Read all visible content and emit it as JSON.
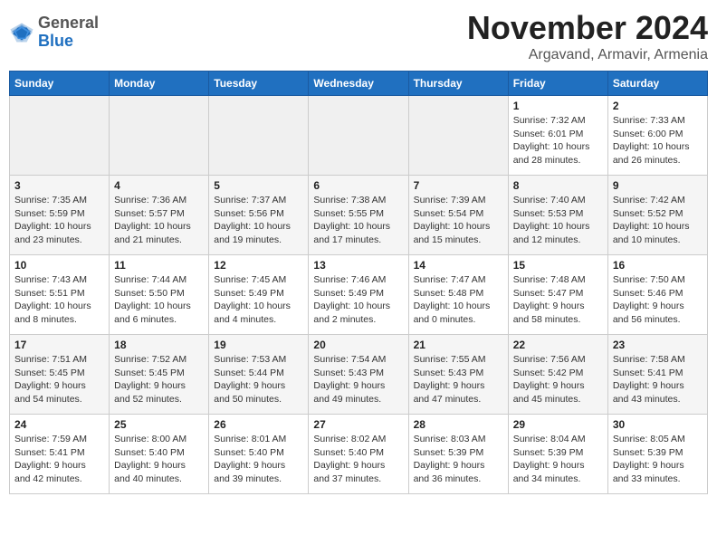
{
  "header": {
    "logo_line1": "General",
    "logo_line2": "Blue",
    "title": "November 2024",
    "subtitle": "Argavand, Armavir, Armenia"
  },
  "calendar": {
    "weekdays": [
      "Sunday",
      "Monday",
      "Tuesday",
      "Wednesday",
      "Thursday",
      "Friday",
      "Saturday"
    ],
    "weeks": [
      [
        {
          "day": "",
          "info": ""
        },
        {
          "day": "",
          "info": ""
        },
        {
          "day": "",
          "info": ""
        },
        {
          "day": "",
          "info": ""
        },
        {
          "day": "",
          "info": ""
        },
        {
          "day": "1",
          "info": "Sunrise: 7:32 AM\nSunset: 6:01 PM\nDaylight: 10 hours and 28 minutes."
        },
        {
          "day": "2",
          "info": "Sunrise: 7:33 AM\nSunset: 6:00 PM\nDaylight: 10 hours and 26 minutes."
        }
      ],
      [
        {
          "day": "3",
          "info": "Sunrise: 7:35 AM\nSunset: 5:59 PM\nDaylight: 10 hours and 23 minutes."
        },
        {
          "day": "4",
          "info": "Sunrise: 7:36 AM\nSunset: 5:57 PM\nDaylight: 10 hours and 21 minutes."
        },
        {
          "day": "5",
          "info": "Sunrise: 7:37 AM\nSunset: 5:56 PM\nDaylight: 10 hours and 19 minutes."
        },
        {
          "day": "6",
          "info": "Sunrise: 7:38 AM\nSunset: 5:55 PM\nDaylight: 10 hours and 17 minutes."
        },
        {
          "day": "7",
          "info": "Sunrise: 7:39 AM\nSunset: 5:54 PM\nDaylight: 10 hours and 15 minutes."
        },
        {
          "day": "8",
          "info": "Sunrise: 7:40 AM\nSunset: 5:53 PM\nDaylight: 10 hours and 12 minutes."
        },
        {
          "day": "9",
          "info": "Sunrise: 7:42 AM\nSunset: 5:52 PM\nDaylight: 10 hours and 10 minutes."
        }
      ],
      [
        {
          "day": "10",
          "info": "Sunrise: 7:43 AM\nSunset: 5:51 PM\nDaylight: 10 hours and 8 minutes."
        },
        {
          "day": "11",
          "info": "Sunrise: 7:44 AM\nSunset: 5:50 PM\nDaylight: 10 hours and 6 minutes."
        },
        {
          "day": "12",
          "info": "Sunrise: 7:45 AM\nSunset: 5:49 PM\nDaylight: 10 hours and 4 minutes."
        },
        {
          "day": "13",
          "info": "Sunrise: 7:46 AM\nSunset: 5:49 PM\nDaylight: 10 hours and 2 minutes."
        },
        {
          "day": "14",
          "info": "Sunrise: 7:47 AM\nSunset: 5:48 PM\nDaylight: 10 hours and 0 minutes."
        },
        {
          "day": "15",
          "info": "Sunrise: 7:48 AM\nSunset: 5:47 PM\nDaylight: 9 hours and 58 minutes."
        },
        {
          "day": "16",
          "info": "Sunrise: 7:50 AM\nSunset: 5:46 PM\nDaylight: 9 hours and 56 minutes."
        }
      ],
      [
        {
          "day": "17",
          "info": "Sunrise: 7:51 AM\nSunset: 5:45 PM\nDaylight: 9 hours and 54 minutes."
        },
        {
          "day": "18",
          "info": "Sunrise: 7:52 AM\nSunset: 5:45 PM\nDaylight: 9 hours and 52 minutes."
        },
        {
          "day": "19",
          "info": "Sunrise: 7:53 AM\nSunset: 5:44 PM\nDaylight: 9 hours and 50 minutes."
        },
        {
          "day": "20",
          "info": "Sunrise: 7:54 AM\nSunset: 5:43 PM\nDaylight: 9 hours and 49 minutes."
        },
        {
          "day": "21",
          "info": "Sunrise: 7:55 AM\nSunset: 5:43 PM\nDaylight: 9 hours and 47 minutes."
        },
        {
          "day": "22",
          "info": "Sunrise: 7:56 AM\nSunset: 5:42 PM\nDaylight: 9 hours and 45 minutes."
        },
        {
          "day": "23",
          "info": "Sunrise: 7:58 AM\nSunset: 5:41 PM\nDaylight: 9 hours and 43 minutes."
        }
      ],
      [
        {
          "day": "24",
          "info": "Sunrise: 7:59 AM\nSunset: 5:41 PM\nDaylight: 9 hours and 42 minutes."
        },
        {
          "day": "25",
          "info": "Sunrise: 8:00 AM\nSunset: 5:40 PM\nDaylight: 9 hours and 40 minutes."
        },
        {
          "day": "26",
          "info": "Sunrise: 8:01 AM\nSunset: 5:40 PM\nDaylight: 9 hours and 39 minutes."
        },
        {
          "day": "27",
          "info": "Sunrise: 8:02 AM\nSunset: 5:40 PM\nDaylight: 9 hours and 37 minutes."
        },
        {
          "day": "28",
          "info": "Sunrise: 8:03 AM\nSunset: 5:39 PM\nDaylight: 9 hours and 36 minutes."
        },
        {
          "day": "29",
          "info": "Sunrise: 8:04 AM\nSunset: 5:39 PM\nDaylight: 9 hours and 34 minutes."
        },
        {
          "day": "30",
          "info": "Sunrise: 8:05 AM\nSunset: 5:39 PM\nDaylight: 9 hours and 33 minutes."
        }
      ]
    ]
  }
}
